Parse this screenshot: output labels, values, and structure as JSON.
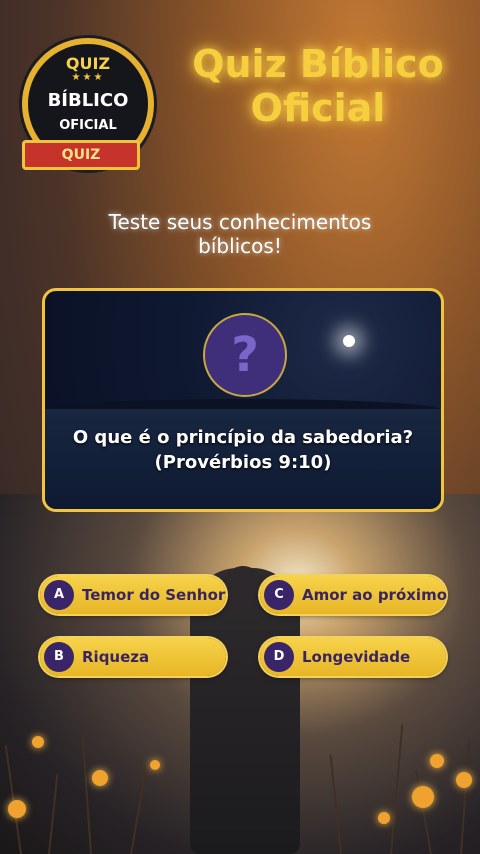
{
  "logo": {
    "top_text": "QUIZ",
    "stars": "★★★",
    "main_text": "BÍBLICO",
    "sub_text": "OFICIAL",
    "ribbon_text": "QUIZ"
  },
  "header": {
    "title_line1": "Quiz Bíblico",
    "title_line2": "Oficial"
  },
  "subtitle": {
    "line1": "Teste seus conhecimentos",
    "line2": "bíblicos!"
  },
  "question_card": {
    "icon": "question-mark-icon",
    "icon_glyph": "?",
    "question_line1": "O que é o princípio da sabedoria?",
    "question_line2": "(Provérbios 9:10)"
  },
  "answers": [
    {
      "letter": "A",
      "text": "Temor do Senhor"
    },
    {
      "letter": "C",
      "text": "Amor ao próximo"
    },
    {
      "letter": "B",
      "text": "Riqueza"
    },
    {
      "letter": "D",
      "text": "Longevidade"
    }
  ],
  "colors": {
    "accent_gold": "#f2c43e",
    "badge_purple": "#3a2568",
    "title_glow": "#f5cf3e"
  }
}
